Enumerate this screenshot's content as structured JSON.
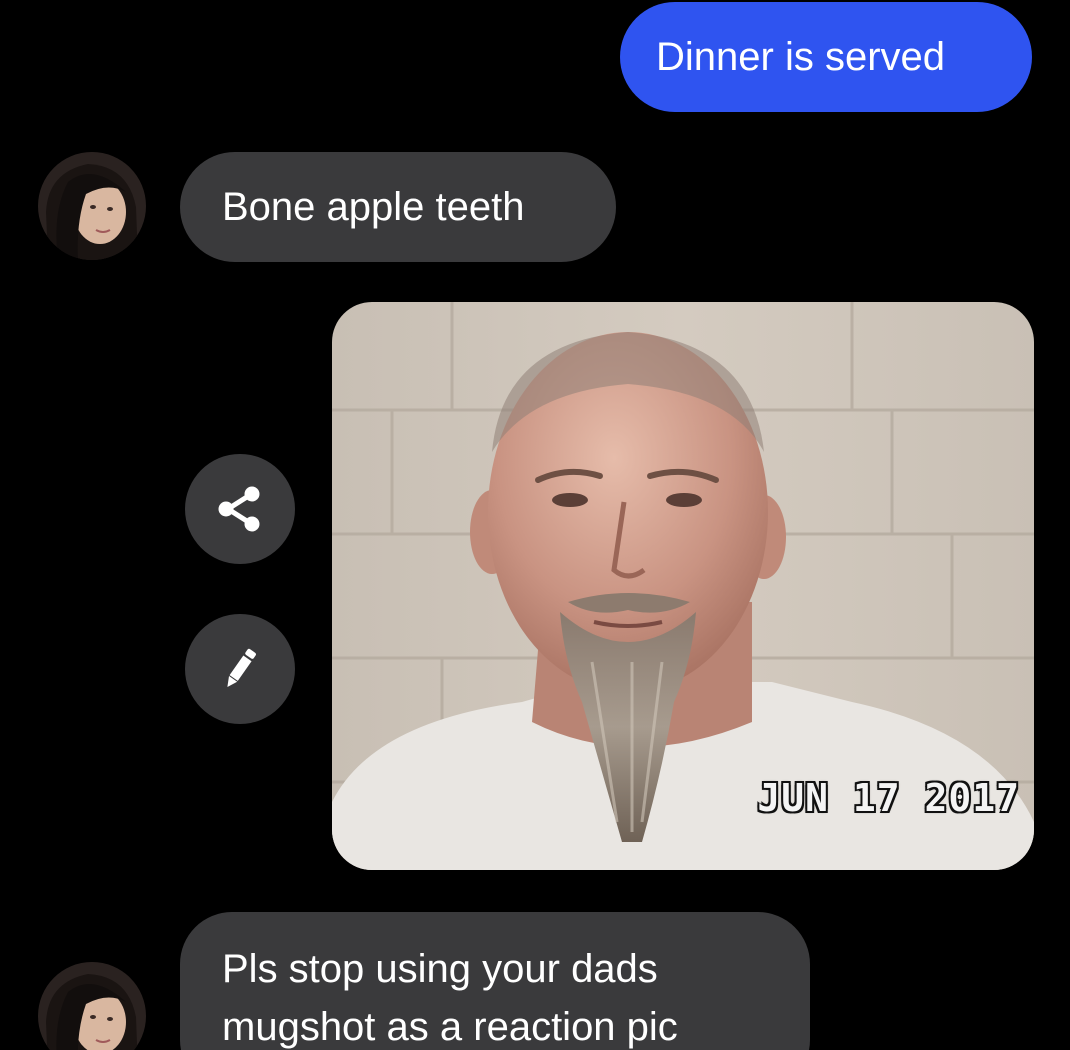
{
  "messages": {
    "sent": {
      "text": "Dinner is served"
    },
    "reply_1": {
      "text": "Bone apple teeth"
    },
    "photo": {
      "date_stamp": "JUN 17 2017"
    },
    "reply_2": {
      "line_1": "Pls stop using your dads",
      "line_2": "mugshot as a reaction pic"
    }
  },
  "actions": {
    "share_icon": "share-icon",
    "edit_icon": "pencil-icon"
  },
  "colors": {
    "background": "#000000",
    "sent_bubble": "#2f54f0",
    "received_bubble": "#3a3a3c",
    "text": "#ffffff"
  }
}
